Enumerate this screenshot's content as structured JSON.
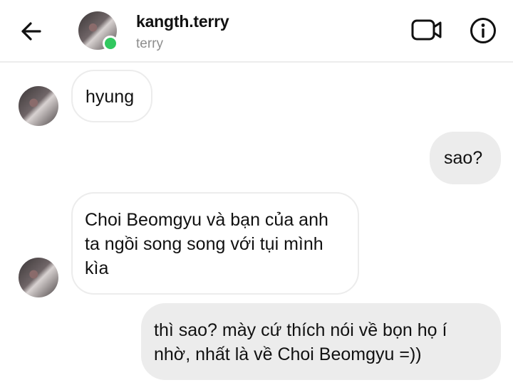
{
  "header": {
    "back_icon": "arrow-left-icon",
    "username": "kangth.terry",
    "subtitle": "terry",
    "online": true,
    "online_color": "#31c85f",
    "video_icon": "video-camera-icon",
    "info_icon": "info-circle-icon"
  },
  "messages": [
    {
      "direction": "incoming",
      "text": "hyung",
      "show_avatar": true
    },
    {
      "direction": "outgoing",
      "text": "sao?"
    },
    {
      "direction": "incoming",
      "text": "Choi Beomgyu và bạn của anh ta ngồi song song với tụi mình kìa",
      "show_avatar": true
    },
    {
      "direction": "outgoing",
      "text": "thì sao? mày cứ thích nói về bọn họ í nhờ, nhất là về Choi Beomgyu =))"
    }
  ],
  "colors": {
    "incoming_bubble_bg": "#ffffff",
    "incoming_bubble_border": "#ececec",
    "outgoing_bubble_bg": "#ececec",
    "text": "#111111",
    "subtitle": "#8e8e8e"
  }
}
